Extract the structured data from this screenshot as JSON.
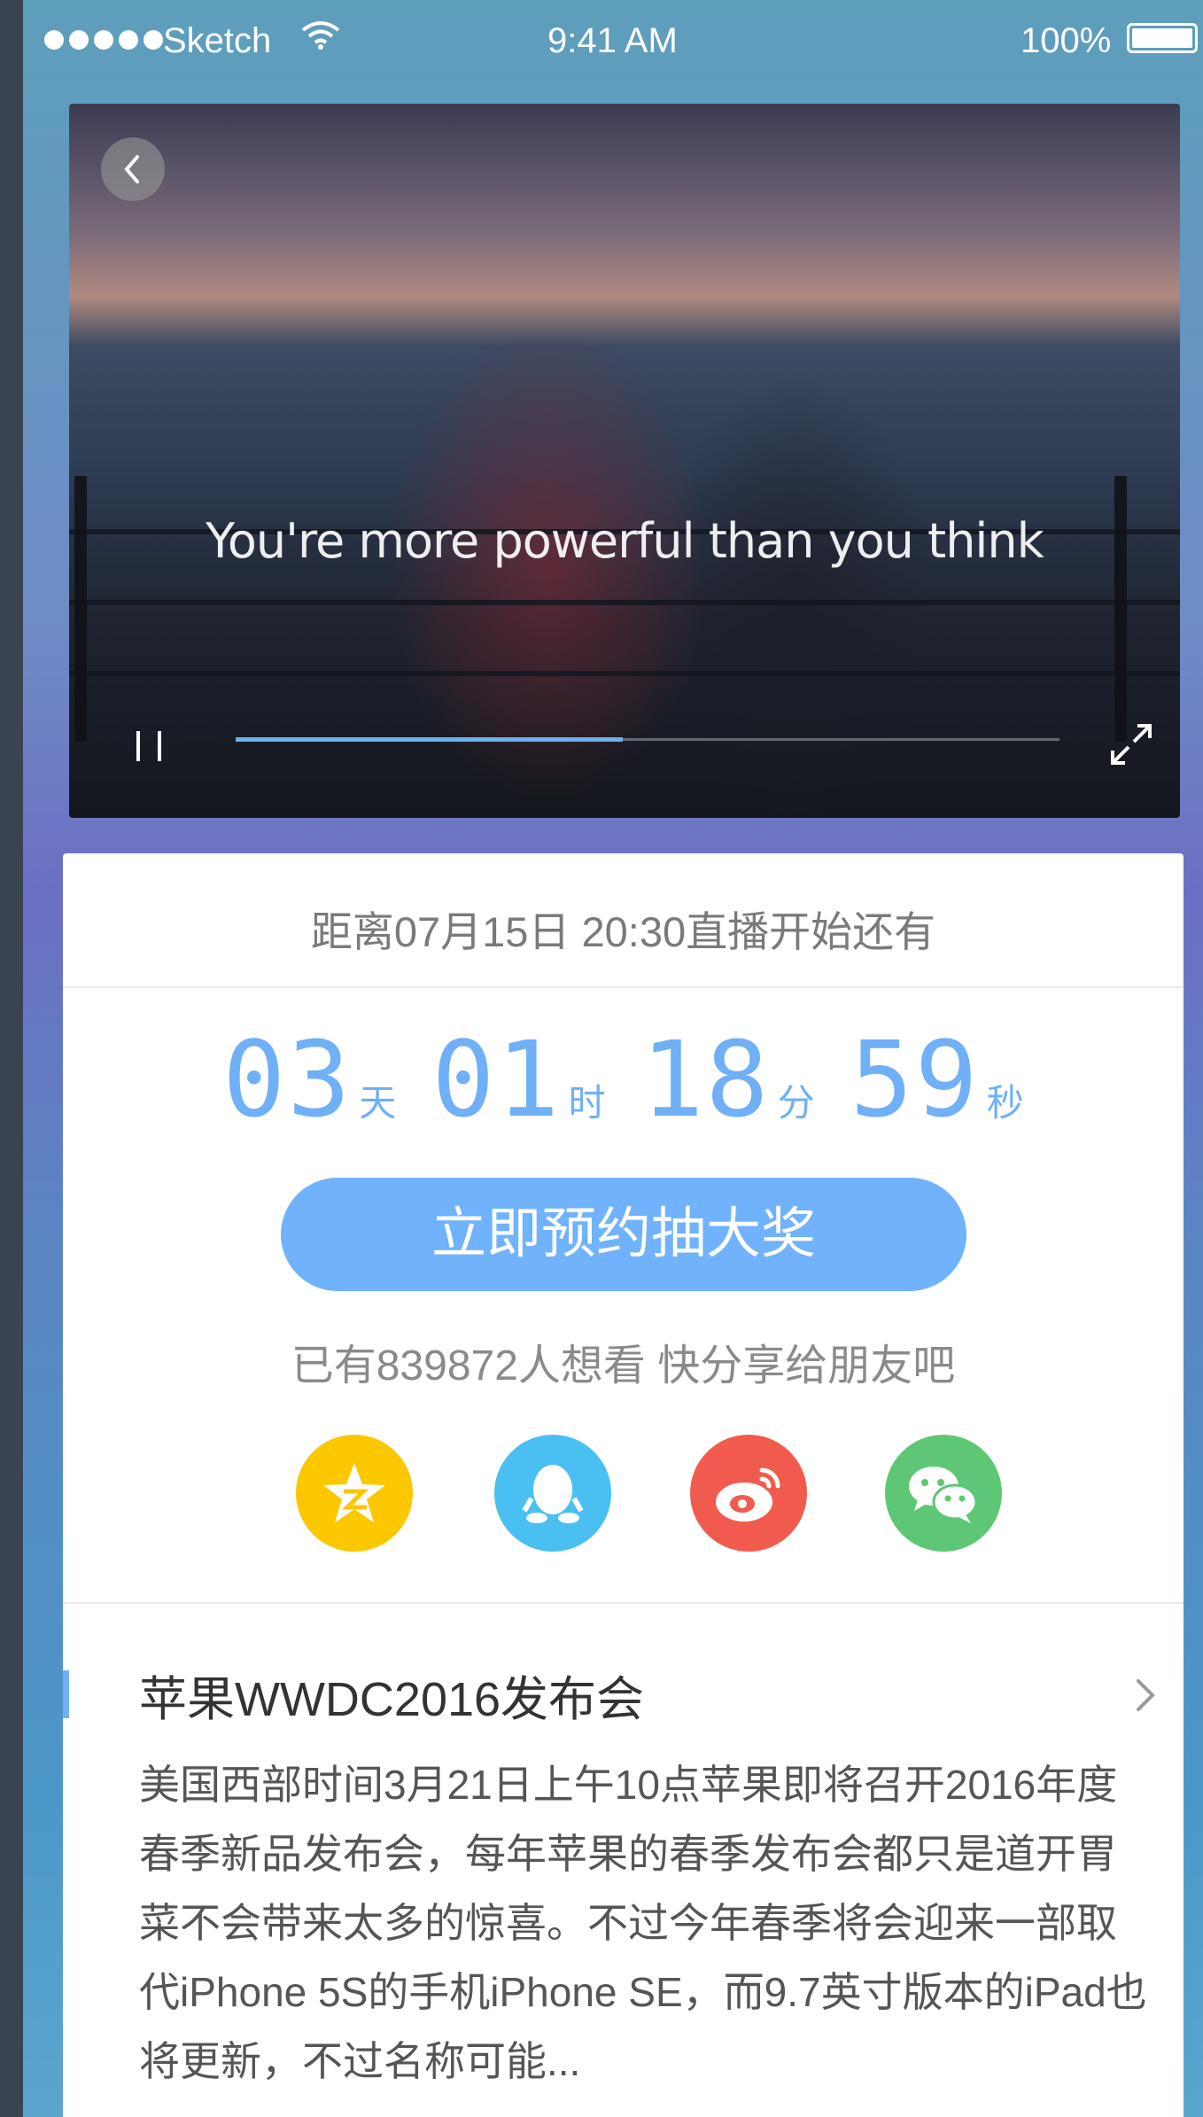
{
  "status_bar": {
    "carrier": "Sketch",
    "time": "9:41 AM",
    "battery": "100%"
  },
  "video": {
    "caption": "You're more powerful than you think",
    "progress": 0.47
  },
  "countdown": {
    "title": "距离07月15日 20:30直播开始还有",
    "days": "03",
    "days_unit": "天",
    "hours": "01",
    "hours_unit": "时",
    "minutes": "18",
    "minutes_unit": "分",
    "seconds": "59",
    "seconds_unit": "秒"
  },
  "reserve_button": "立即预约抽大奖",
  "watchers_text": "已有839872人想看 快分享给朋友吧",
  "share": {
    "items": [
      {
        "icon": "qzone-icon",
        "color": "#fbc800"
      },
      {
        "icon": "qq-icon",
        "color": "#4ac0f2"
      },
      {
        "icon": "weibo-icon",
        "color": "#f15b4d"
      },
      {
        "icon": "wechat-icon",
        "color": "#5ec775"
      }
    ]
  },
  "news": {
    "title": "苹果WWDC2016发布会",
    "body": "美国西部时间3月21日上午10点苹果即将召开2016年度春季新品发布会，每年苹果的春季发布会都只是道开胃菜不会带来太多的惊喜。不过今年春季将会迎来一部取代iPhone 5S的手机iPhone SE，而9.7英寸版本的iPad也将更新，不过名称可能..."
  }
}
